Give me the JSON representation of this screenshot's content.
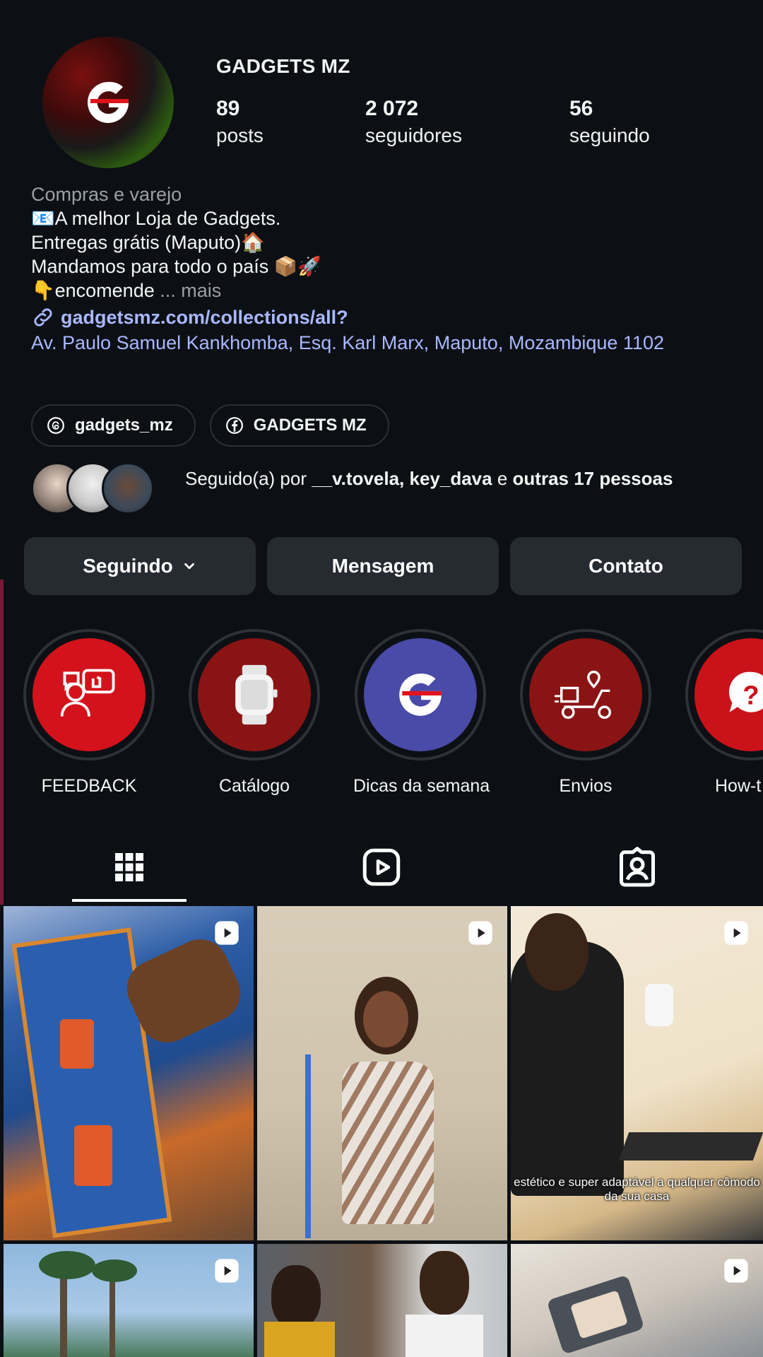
{
  "profile": {
    "username": "GADGETS MZ",
    "stats": [
      {
        "value": "89",
        "label": "posts"
      },
      {
        "value": "2 072",
        "label": "seguidores"
      },
      {
        "value": "56",
        "label": "seguindo"
      }
    ],
    "category": "Compras e varejo",
    "bio_lines": [
      "📧A melhor Loja de Gadgets.",
      "Entregas grátis (Maputo)🏠",
      "Mandamos para todo o país 📦🚀",
      "👇encomende"
    ],
    "more_label": "... mais",
    "link": "gadgetsmz.com/collections/all?",
    "address": "Av. Paulo Samuel Kankhomba, Esq. Karl Marx, Maputo, Mozambique 1102"
  },
  "chips": [
    {
      "label": "gadgets_mz",
      "icon": "threads-icon"
    },
    {
      "label": "GADGETS MZ",
      "icon": "facebook-icon"
    }
  ],
  "followed_by": {
    "prefix": "Seguido(a) por ",
    "names": "__v.tovela, key_dava",
    "middle": " e ",
    "others": "outras 17 pessoas"
  },
  "actions": {
    "following": "Seguindo",
    "message": "Mensagem",
    "contact": "Contato"
  },
  "highlights": [
    {
      "label": "FEEDBACK",
      "icon": "feedback-icon"
    },
    {
      "label": "Catálogo",
      "icon": "smartwatch-icon"
    },
    {
      "label": "Dicas da semana",
      "icon": "g-logo-icon"
    },
    {
      "label": "Envios",
      "icon": "delivery-scooter-icon"
    },
    {
      "label": "How-t",
      "icon": "question-icon"
    }
  ],
  "tabs": [
    "grid-icon",
    "reels-icon",
    "tagged-icon"
  ],
  "posts": [
    {
      "caption": ""
    },
    {
      "caption": ""
    },
    {
      "caption": "estético e super adaptável a qualquer cômodo da sua casa"
    },
    {
      "caption": ""
    },
    {
      "caption": ""
    },
    {
      "caption": ""
    }
  ],
  "colors": {
    "background": "#0c1015",
    "button": "#262a31",
    "link": "#a9b8ff",
    "highlight_red": "#d3121b",
    "highlight_dark_red": "#8a1414",
    "highlight_blue": "#4a4aa8"
  }
}
